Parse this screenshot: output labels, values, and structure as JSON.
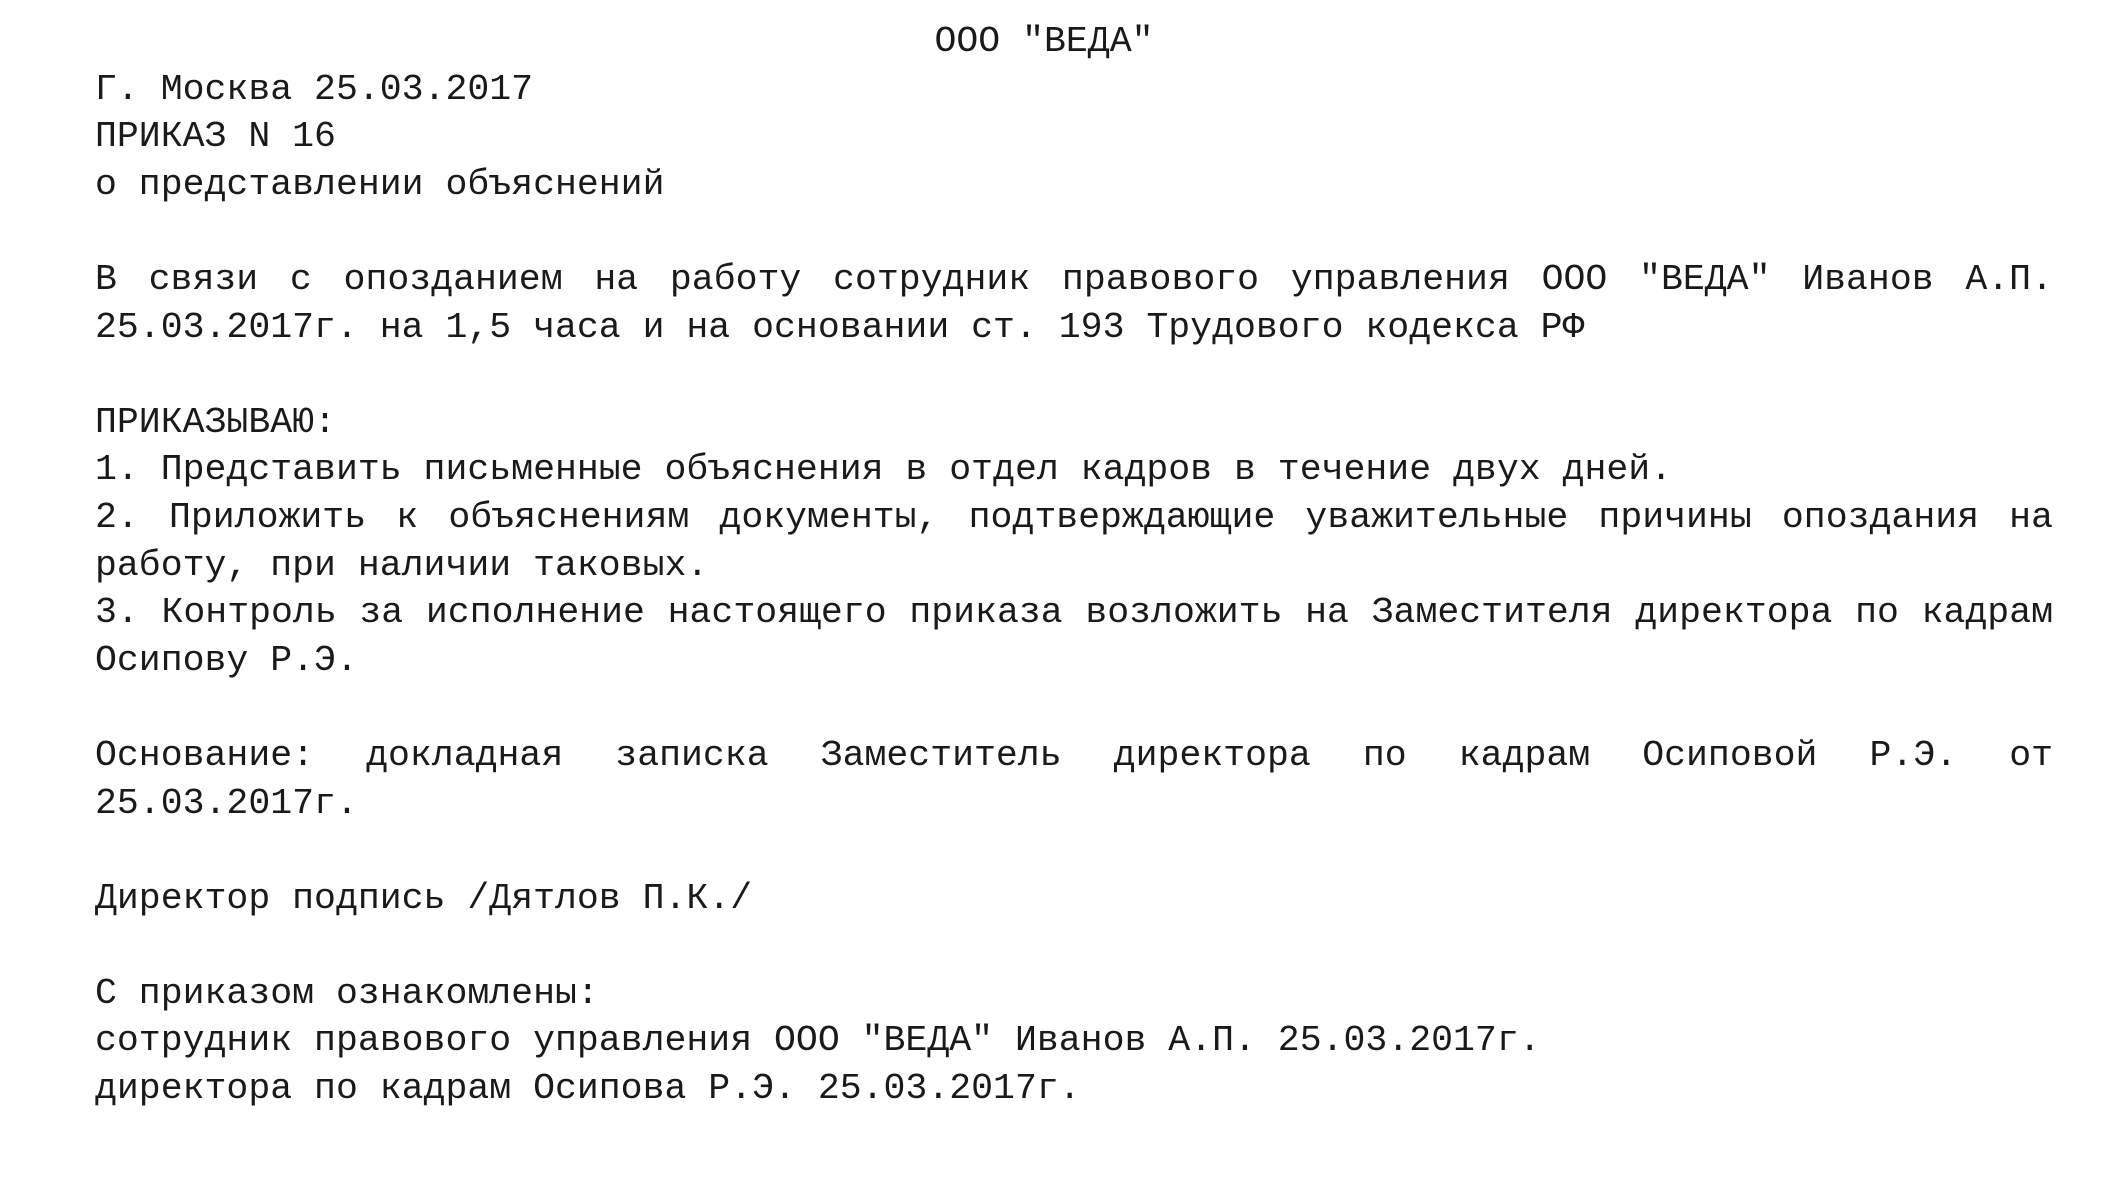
{
  "header": {
    "company": "ООО \"ВЕДА\"",
    "city_date": "Г. Москва 25.03.2017",
    "order_number": "ПРИКАЗ N 16",
    "order_subject": "о представлении объяснений"
  },
  "preamble": "В связи с опозданием на работу сотрудник правового управления ООО \"ВЕДА\" Иванов А.П. 25.03.2017г. на 1,5 часа и на основании ст. 193 Трудового кодекса РФ",
  "order_heading": "ПРИКАЗЫВАЮ:",
  "items": [
    "1. Представить письменные объяснения в отдел кадров в течение двух дней.",
    "2. Приложить к объяснениям документы, подтверждающие уважительные причины опоздания на работу, при наличии таковых.",
    "3. Контроль за исполнение настоящего приказа возложить на Заместителя директора по кадрам Осипову Р.Э."
  ],
  "basis": "Основание: докладная записка Заместитель директора по кадрам Осиповой Р.Э. от 25.03.2017г.",
  "signature": "Директор подпись /Дятлов П.К./",
  "acknowledged": {
    "heading": "С приказом ознакомлены:",
    "entries": [
      "сотрудник правового управления ООО \"ВЕДА\" Иванов А.П. 25.03.2017г.",
      "директора по кадрам Осипова Р.Э. 25.03.2017г."
    ]
  }
}
